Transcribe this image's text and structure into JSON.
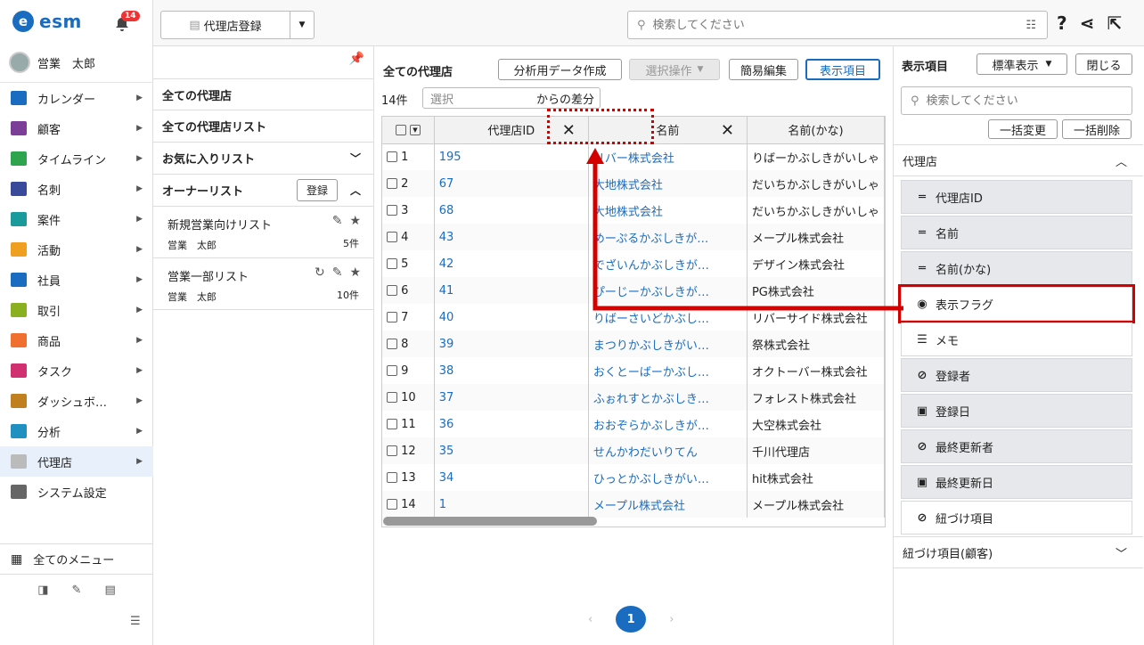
{
  "app": {
    "logo": "esm",
    "logo_mark": "e",
    "notifications": "14",
    "user": "営業　太郎"
  },
  "menu": [
    {
      "label": "カレンダー",
      "icon": "calendar-icon",
      "color": "#1a6cc0"
    },
    {
      "label": "顧客",
      "icon": "building-icon",
      "color": "#7b3f98"
    },
    {
      "label": "タイムライン",
      "icon": "chat-icon",
      "color": "#2ea44f"
    },
    {
      "label": "名刺",
      "icon": "card-icon",
      "color": "#3a4a9a"
    },
    {
      "label": "案件",
      "icon": "case-icon",
      "color": "#1a9a9a"
    },
    {
      "label": "活動",
      "icon": "activity-icon",
      "color": "#f0a020"
    },
    {
      "label": "社員",
      "icon": "person-icon",
      "color": "#1a6cc0"
    },
    {
      "label": "取引",
      "icon": "deal-icon",
      "color": "#8ab020"
    },
    {
      "label": "商品",
      "icon": "product-icon",
      "color": "#f07030"
    },
    {
      "label": "タスク",
      "icon": "task-icon",
      "color": "#d03070"
    },
    {
      "label": "ダッシュボ…",
      "icon": "dashboard-icon",
      "color": "#c08020"
    },
    {
      "label": "分析",
      "icon": "analysis-icon",
      "color": "#2090c0"
    },
    {
      "label": "代理店",
      "icon": "agency-icon",
      "color": "#bbbbbb"
    },
    {
      "label": "システム設定",
      "icon": "gear-icon",
      "color": "#666666"
    }
  ],
  "all_menu": "全てのメニュー",
  "topbar": {
    "register": "代理店登録",
    "search_placeholder": "検索してください"
  },
  "lists": {
    "all": "全ての代理店",
    "all_list": "全ての代理店リスト",
    "fav": "お気に入りリスト",
    "owner": "オーナーリスト",
    "register": "登録",
    "items": [
      {
        "title": "新規営業向けリスト",
        "user": "営業　太郎",
        "count": "5件"
      },
      {
        "title": "営業一部リスト",
        "user": "営業　太郎",
        "count": "10件"
      }
    ]
  },
  "main": {
    "title": "全ての代理店",
    "btn_export": "分析用データ作成",
    "btn_select": "選択操作",
    "btn_edit": "簡易編集",
    "btn_display": "表示項目",
    "count": "14件",
    "diff_placeholder": "選択",
    "diff_suffix": "からの差分",
    "columns": [
      "代理店ID",
      "名前",
      "名前(かな)"
    ],
    "rows": [
      [
        "1",
        "195",
        "リバー株式会社",
        "りばーかぶしきがいしゃ"
      ],
      [
        "2",
        "67",
        "大地株式会社",
        "だいちかぶしきがいしゃ"
      ],
      [
        "3",
        "68",
        "大地株式会社",
        "だいちかぶしきがいしゃ"
      ],
      [
        "4",
        "43",
        "めーぷるかぶしきが…",
        "メープル株式会社"
      ],
      [
        "5",
        "42",
        "でざいんかぶしきが…",
        "デザイン株式会社"
      ],
      [
        "6",
        "41",
        "ぴーじーかぶしきが…",
        "PG株式会社"
      ],
      [
        "7",
        "40",
        "りばーさいどかぶし…",
        "リバーサイド株式会社"
      ],
      [
        "8",
        "39",
        "まつりかぶしきがい…",
        "祭株式会社"
      ],
      [
        "9",
        "38",
        "おくとーばーかぶし…",
        "オクトーバー株式会社"
      ],
      [
        "10",
        "37",
        "ふぉれすとかぶしき…",
        "フォレスト株式会社"
      ],
      [
        "11",
        "36",
        "おおぞらかぶしきが…",
        "大空株式会社"
      ],
      [
        "12",
        "35",
        "せんかわだいりてん",
        "千川代理店"
      ],
      [
        "13",
        "34",
        "ひっとかぶしきがい…",
        "hit株式会社"
      ],
      [
        "14",
        "1",
        "メープル株式会社",
        "メープル株式会社"
      ]
    ],
    "page": "1"
  },
  "panel": {
    "title": "表示項目",
    "preset": "標準表示",
    "close": "閉じる",
    "search_placeholder": "検索してください",
    "bulk_change": "一括変更",
    "bulk_delete": "一括削除",
    "section": "代理店",
    "fields": [
      {
        "label": "代理店ID",
        "icon": "text-icon",
        "active": true
      },
      {
        "label": "名前",
        "icon": "text-icon",
        "active": true
      },
      {
        "label": "名前(かな)",
        "icon": "text-icon",
        "active": true
      },
      {
        "label": "表示フラグ",
        "icon": "dropdown-icon",
        "active": false
      },
      {
        "label": "メモ",
        "icon": "memo-icon",
        "active": false
      },
      {
        "label": "登録者",
        "icon": "link-icon",
        "active": true
      },
      {
        "label": "登録日",
        "icon": "calendar-icon",
        "active": true
      },
      {
        "label": "最終更新者",
        "icon": "link-icon",
        "active": true
      },
      {
        "label": "最終更新日",
        "icon": "calendar-icon",
        "active": true
      },
      {
        "label": "紐づけ項目",
        "icon": "link-icon",
        "active": false
      }
    ],
    "section2": "紐づけ項目(顧客)"
  },
  "colors": {
    "accent": "#1a6cc0",
    "annotation": "#d40000"
  }
}
